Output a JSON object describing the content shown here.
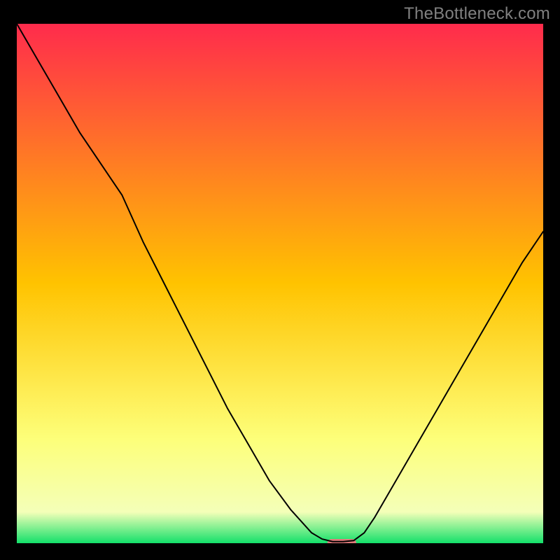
{
  "watermark": {
    "text": "TheBottleneck.com"
  },
  "chart_data": {
    "type": "line",
    "title": "",
    "xlabel": "",
    "ylabel": "",
    "xlim": [
      0,
      100
    ],
    "ylim": [
      0,
      100
    ],
    "grid": false,
    "legend": false,
    "background_gradient": {
      "stops": [
        {
          "offset": 0.0,
          "color": "#ff2b4c"
        },
        {
          "offset": 0.5,
          "color": "#ffc300"
        },
        {
          "offset": 0.8,
          "color": "#fdff7a"
        },
        {
          "offset": 0.94,
          "color": "#f4ffb8"
        },
        {
          "offset": 1.0,
          "color": "#13e06a"
        }
      ]
    },
    "series": [
      {
        "name": "bottleneck-curve",
        "color": "#000000",
        "width": 2,
        "x": [
          0.0,
          4.0,
          8.0,
          12.0,
          16.0,
          20.0,
          24.0,
          28.0,
          32.0,
          36.0,
          40.0,
          44.0,
          48.0,
          52.0,
          56.0,
          58.0,
          60.0,
          62.0,
          64.0,
          66.0,
          68.0,
          72.0,
          76.0,
          80.0,
          84.0,
          88.0,
          92.0,
          96.0,
          100.0
        ],
        "y": [
          100.0,
          93.0,
          86.0,
          79.0,
          73.0,
          67.0,
          58.0,
          50.0,
          42.0,
          34.0,
          26.0,
          19.0,
          12.0,
          6.5,
          2.0,
          0.8,
          0.3,
          0.3,
          0.5,
          2.0,
          5.0,
          12.0,
          19.0,
          26.0,
          33.0,
          40.0,
          47.0,
          54.0,
          60.0
        ]
      }
    ],
    "marker": {
      "x_range": [
        59.0,
        64.5
      ],
      "y": 0.0,
      "color": "#e07a7a",
      "thickness": 12
    }
  }
}
